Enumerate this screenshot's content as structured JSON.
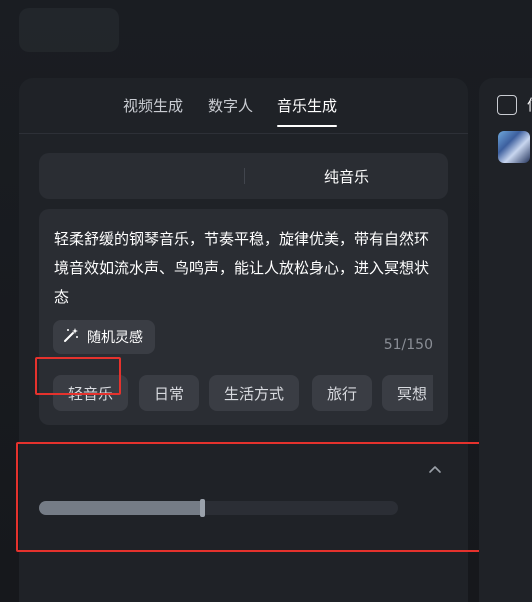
{
  "tabs": [
    {
      "label": "视频生成"
    },
    {
      "label": "数字人"
    },
    {
      "label": "音乐生成",
      "active": true
    }
  ],
  "mode_switch": {
    "right_label": "纯音乐"
  },
  "prompt": {
    "text": "轻柔舒缓的钢琴音乐，节奏平稳，旋律优美，带有自然环境音效如流水声、鸟鸣声，能让人放松身心，进入冥想状态",
    "counter": "51/150",
    "inspire_label": "随机灵感"
  },
  "chips": [
    "轻音乐",
    "日常",
    "生活方式",
    "旅行",
    "冥想"
  ],
  "progress": {
    "fraction": 0.455
  },
  "right_panel": {
    "label": "信"
  },
  "colors": {
    "accent": "#ffffff",
    "highlight_box": "#e5322d",
    "panel": "#1f2227"
  }
}
